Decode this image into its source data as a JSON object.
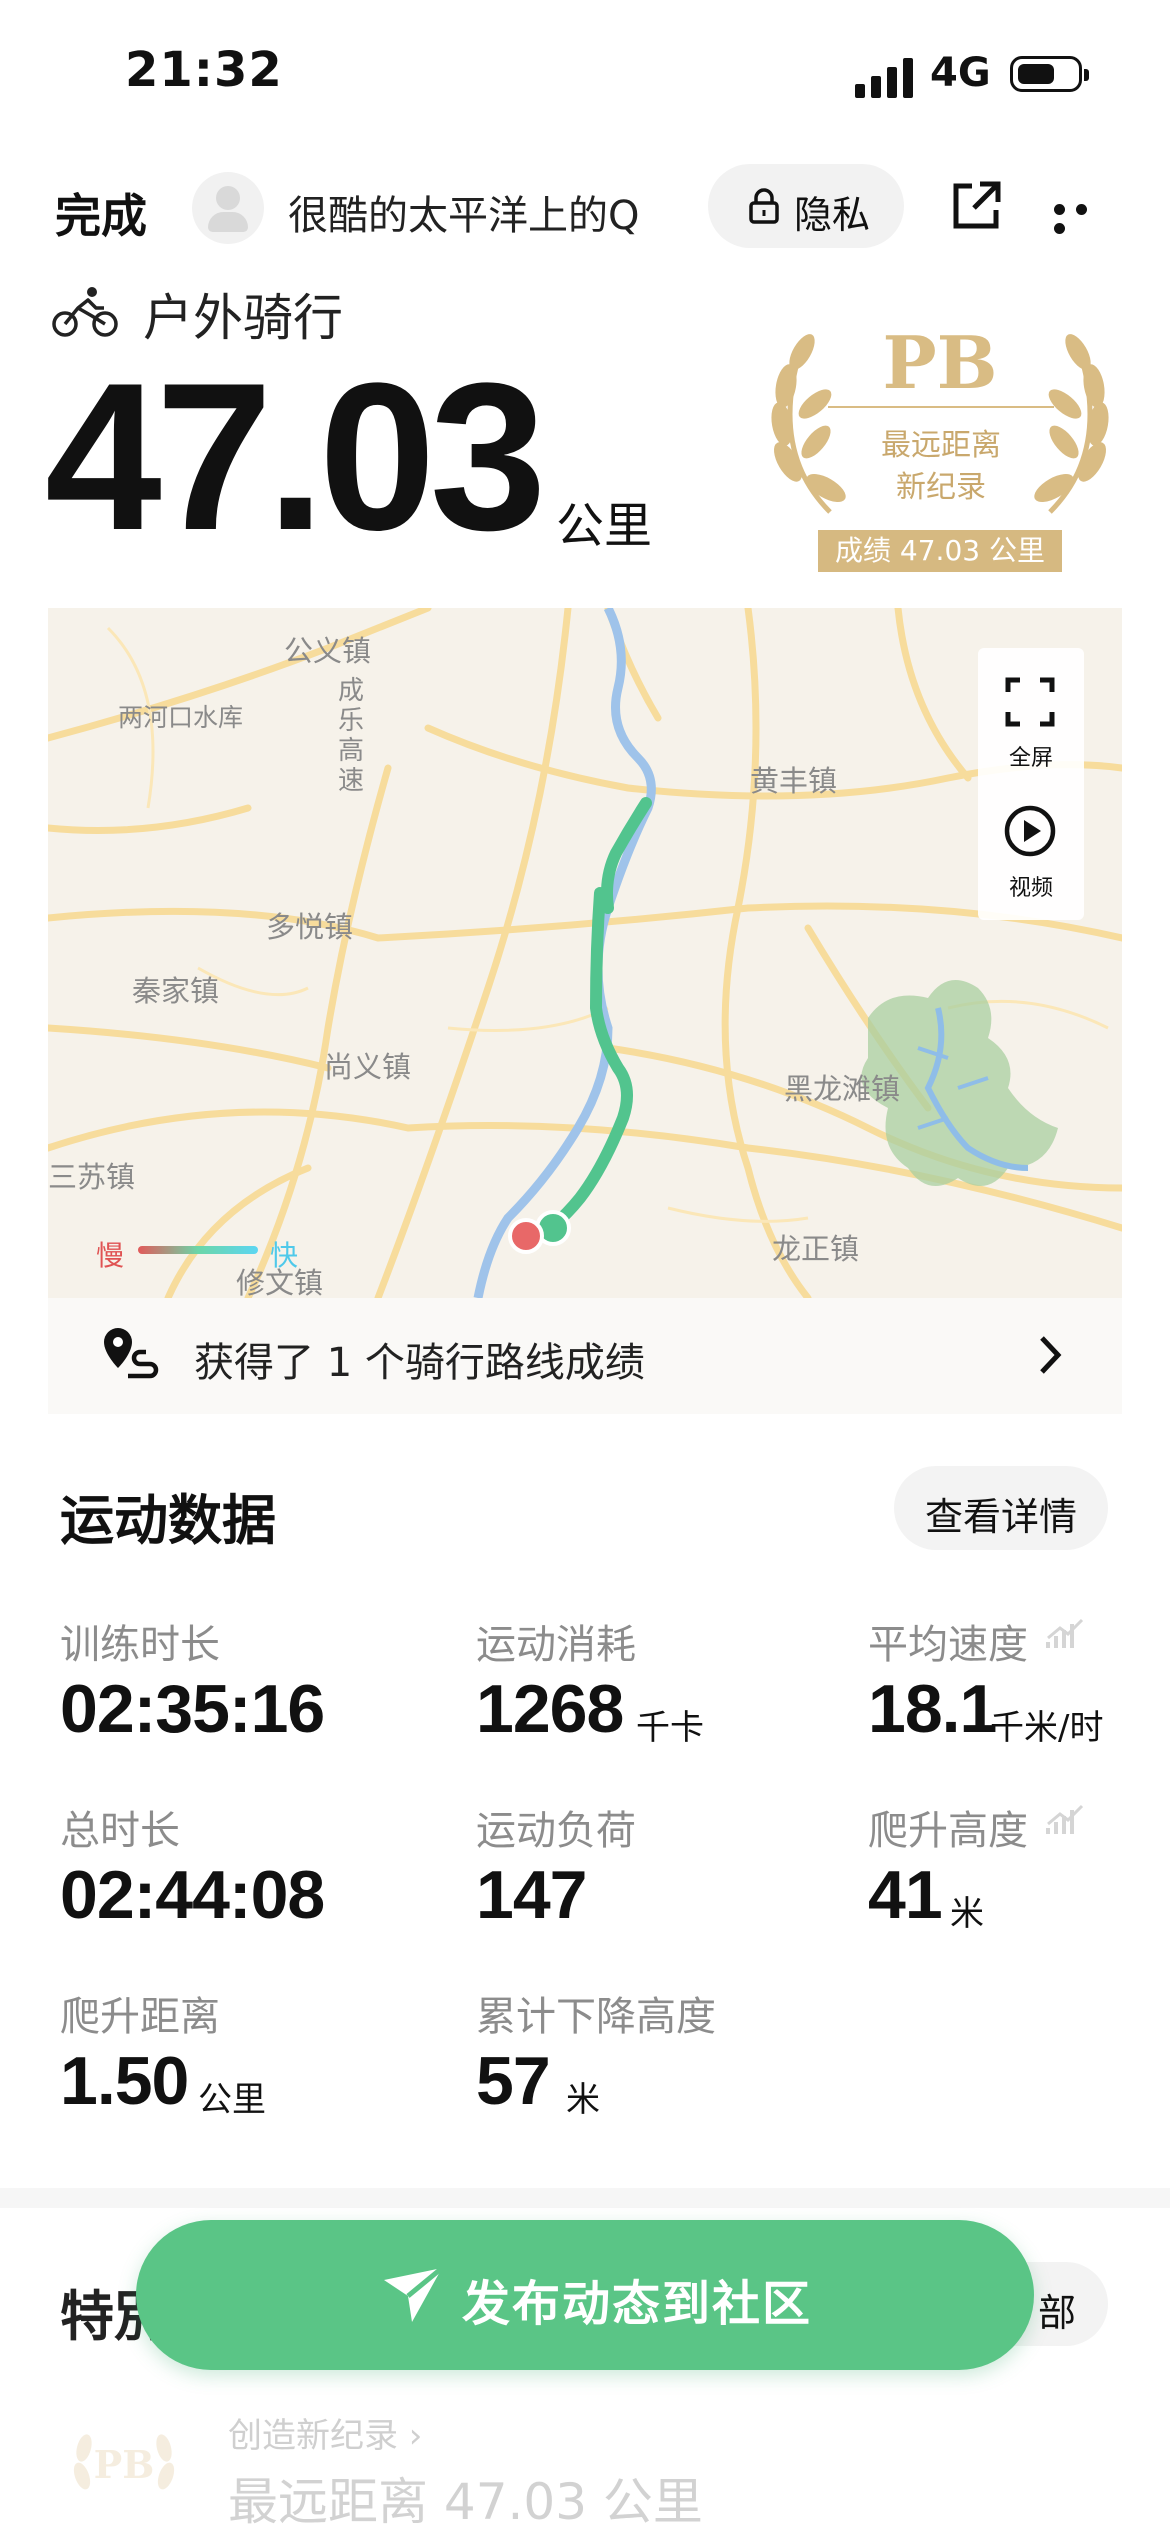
{
  "status_bar": {
    "time": "21:32",
    "network": "4G"
  },
  "header": {
    "done_label": "完成",
    "username": "很酷的太平洋上的Q",
    "privacy_label": "隐私"
  },
  "activity": {
    "type": "户外骑行",
    "distance": "47.03",
    "distance_unit": "公里"
  },
  "pb_badge": {
    "title": "PB",
    "line1": "最远距离",
    "line2": "新纪录",
    "score": "成绩 47.03 公里"
  },
  "map": {
    "fullscreen_label": "全屏",
    "video_label": "视频",
    "legend_slow": "慢",
    "legend_fast": "快",
    "places": [
      "公义镇",
      "两河口水库",
      "成乐高速",
      "黄丰镇",
      "多悦镇",
      "秦家镇",
      "尚义镇",
      "黑龙滩镇",
      "三苏镇",
      "龙正镇",
      "修文镇"
    ]
  },
  "route_achievement": {
    "text": "获得了 1 个骑行路线成绩"
  },
  "stats_section": {
    "title": "运动数据",
    "detail_button": "查看详情",
    "items": [
      {
        "label": "训练时长",
        "value": "02:35:16",
        "unit": ""
      },
      {
        "label": "运动消耗",
        "value": "1268",
        "unit": "千卡"
      },
      {
        "label": "平均速度",
        "value": "18.1",
        "unit": "千米/时"
      },
      {
        "label": "总时长",
        "value": "02:44:08",
        "unit": ""
      },
      {
        "label": "运动负荷",
        "value": "147",
        "unit": ""
      },
      {
        "label": "爬升高度",
        "value": "41",
        "unit": "米"
      },
      {
        "label": "爬升距离",
        "value": "1.50",
        "unit": "公里"
      },
      {
        "label": "累计下降高度",
        "value": "57",
        "unit": "米"
      }
    ]
  },
  "bottom": {
    "section_title_partial": "特別",
    "all_button_partial": "部",
    "publish_button": "发布动态到社区",
    "record_title": "创造新纪录 ›",
    "record_value": "最远距离 47.03 公里"
  },
  "colors": {
    "accent_green": "#5ac586",
    "gold": "#d9bc84",
    "route": "#52c48e"
  }
}
